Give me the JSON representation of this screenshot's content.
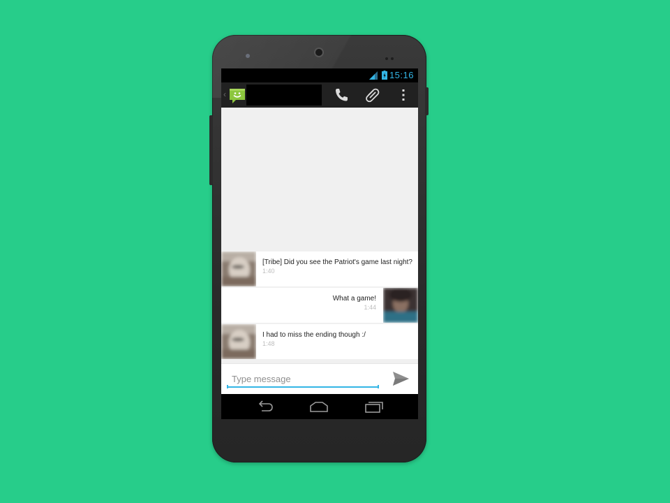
{
  "status_bar": {
    "time": "15:16"
  },
  "action_bar": {
    "contact_name": "",
    "icons": [
      "messaging-app-icon",
      "phone-call-icon",
      "attach-icon",
      "overflow-menu-icon"
    ]
  },
  "messages": [
    {
      "direction": "incoming",
      "text": "[Tribe] Did you see the Patriot's game last night?",
      "time": "1:40"
    },
    {
      "direction": "outgoing",
      "text": "What a game!",
      "time": "1:44"
    },
    {
      "direction": "incoming",
      "text": "I had to miss the ending though :/",
      "time": "1:48"
    }
  ],
  "compose": {
    "placeholder": "Type message",
    "value": ""
  },
  "nav_bar": {
    "icons": [
      "back-icon",
      "home-icon",
      "recents-icon"
    ]
  },
  "colors": {
    "background": "#27cd8a",
    "accent": "#33b5e5",
    "app_icon": "#8cc63e"
  }
}
